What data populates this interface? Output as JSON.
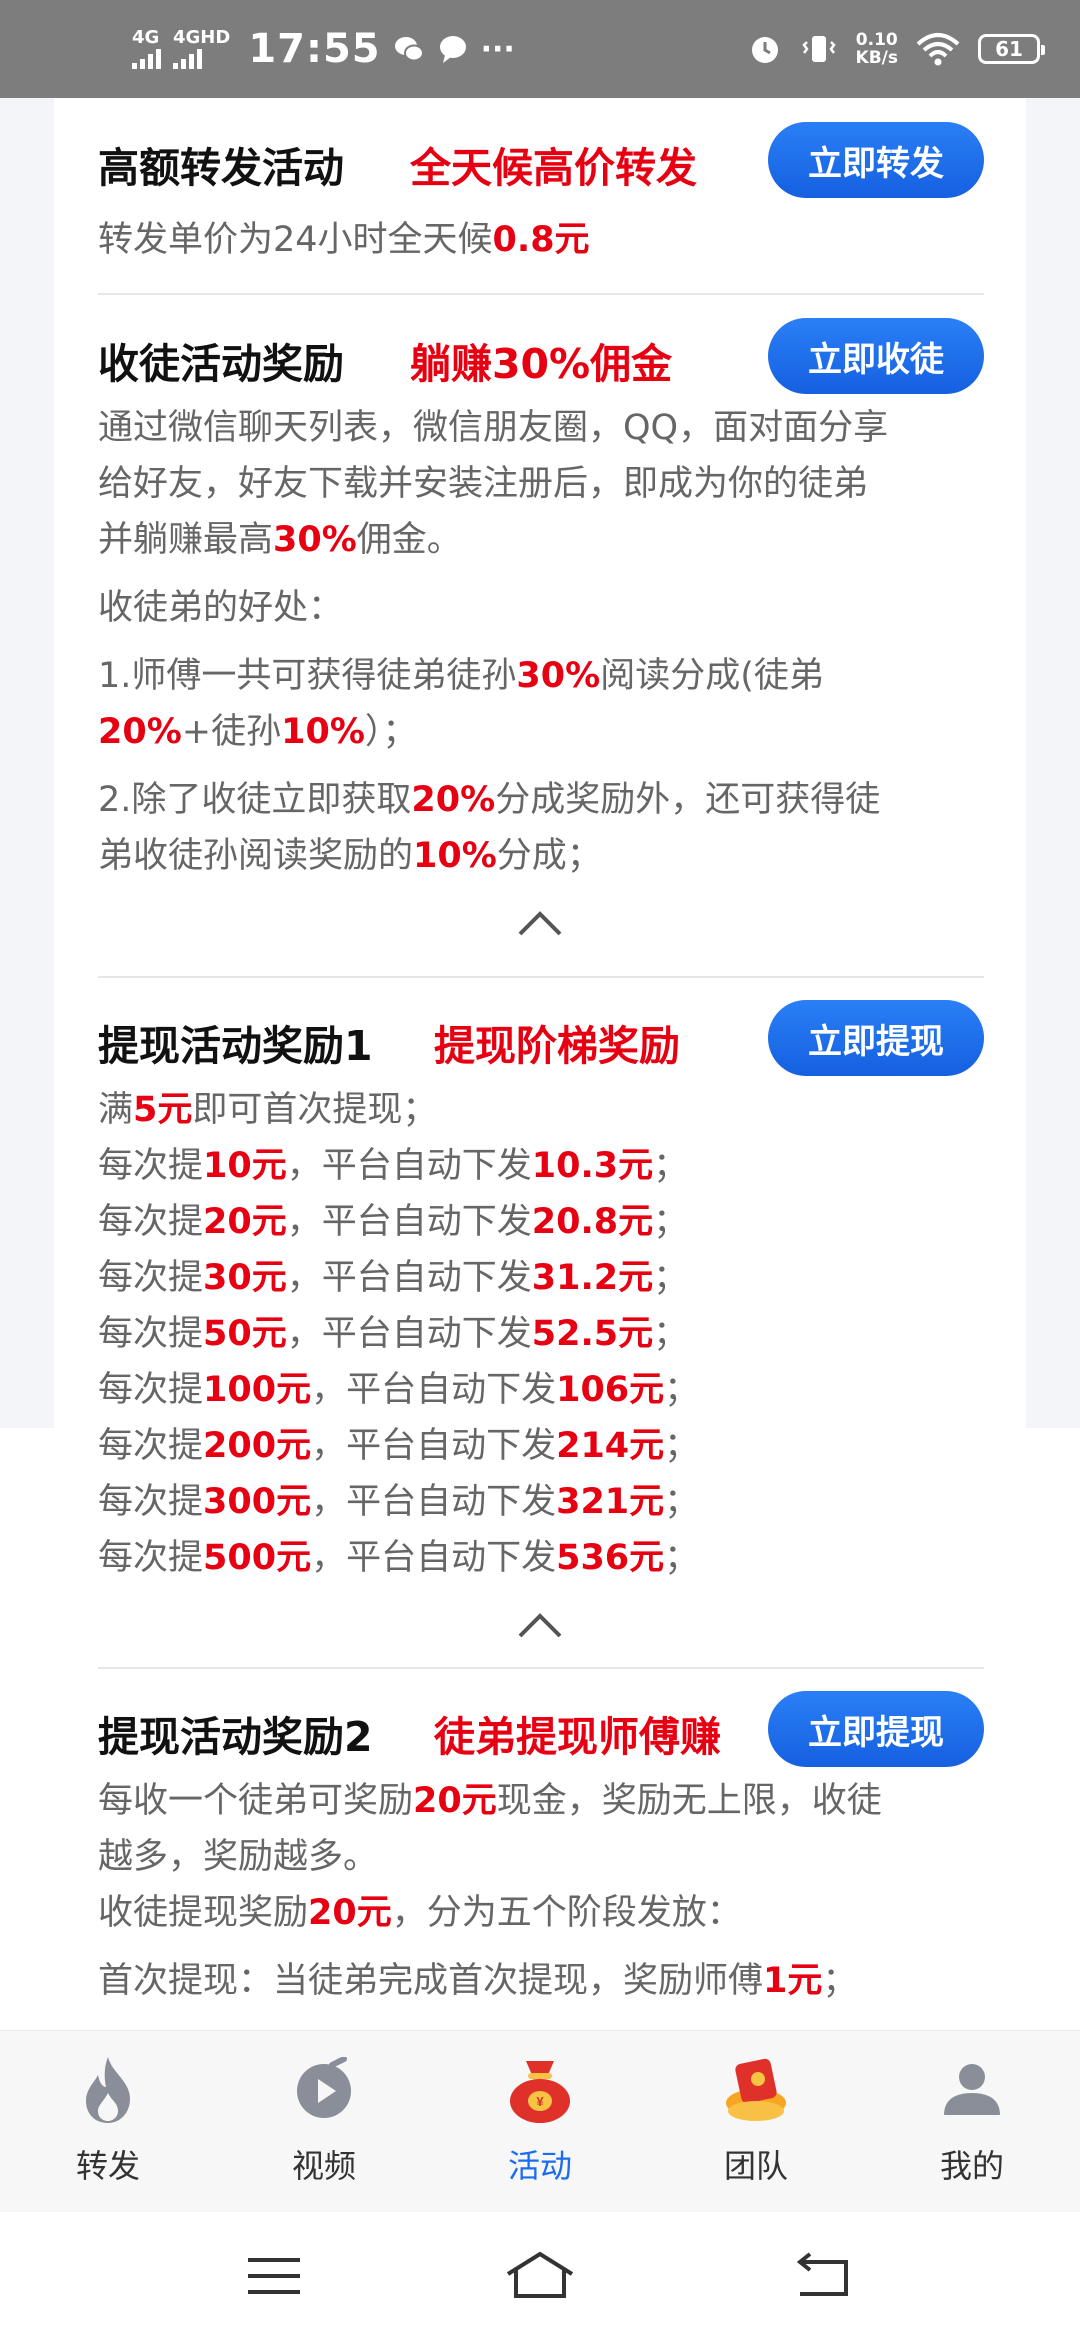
{
  "status_bar": {
    "sim1": "4G",
    "sim2": "4GHD",
    "time": "17:55",
    "more": "···",
    "speed_value": "0.10",
    "speed_unit": "KB/s",
    "battery": "61"
  },
  "sections": {
    "forward": {
      "title": "高额转发活动",
      "highlight": "全天候高价转发",
      "button": "立即转发",
      "line1_prefix": "转发单价为24小时全天候",
      "line1_value": "0.8元"
    },
    "recruit": {
      "title": "收徒活动奖励",
      "highlight": "躺赚30%佣金",
      "button": "立即收徒",
      "p1_l1": "通过微信聊天列表，微信朋友圈，QQ，面对面分享",
      "p1_l2": "给好友，好友下载并安装注册后，即成为你的徒弟",
      "p1_l3_a": "并躺赚最高",
      "p1_l3_b": "30%",
      "p1_l3_c": "佣金。",
      "benefit_title": "收徒弟的好处：",
      "b1_a": "1.师傅一共可获得徒弟徒孙",
      "b1_b": "30%",
      "b1_c": "阅读分成(徒弟",
      "b1_d": "20%",
      "b1_e": "+徒孙",
      "b1_f": "10%",
      "b1_g": "）；",
      "b2_a": "2.除了收徒立即获取",
      "b2_b": "20%",
      "b2_c": "分成奖励外，还可获得徒",
      "b2_d": "弟收徒孙阅读奖励的",
      "b2_e": "10%",
      "b2_f": "分成；"
    },
    "withdraw1": {
      "title": "提现活动奖励1",
      "highlight": "提现阶梯奖励",
      "button": "立即提现",
      "first_a": "满",
      "first_b": "5元",
      "first_c": "即可首次提现；",
      "row_prefix": "每次提",
      "row_mid": "，平台自动下发",
      "row_end": "；",
      "rows": [
        {
          "amount": "10元",
          "payout": "10.3元"
        },
        {
          "amount": "20元",
          "payout": "20.8元"
        },
        {
          "amount": "30元",
          "payout": "31.2元"
        },
        {
          "amount": "50元",
          "payout": "52.5元"
        },
        {
          "amount": "100元",
          "payout": "106元"
        },
        {
          "amount": "200元",
          "payout": "214元"
        },
        {
          "amount": "300元",
          "payout": "321元"
        },
        {
          "amount": "500元",
          "payout": "536元"
        }
      ]
    },
    "withdraw2": {
      "title": "提现活动奖励2",
      "highlight": "徒弟提现师傅赚",
      "button": "立即提现",
      "l1_a": "每收一个徒弟可奖励",
      "l1_b": "20元",
      "l1_c": "现金，奖励无上限，收徒",
      "l2": "越多，奖励越多。",
      "l3_a": "收徒提现奖励",
      "l3_b": "20元",
      "l3_c": "，分为五个阶段发放：",
      "l4_a": "首次提现：当徒弟完成首次提现，奖励师傅",
      "l4_b": "1元",
      "l4_c": "；"
    }
  },
  "nav": {
    "items": [
      {
        "label": "转发"
      },
      {
        "label": "视频"
      },
      {
        "label": "活动"
      },
      {
        "label": "团队"
      },
      {
        "label": "我的"
      }
    ]
  },
  "colors": {
    "accent_blue": "#1a6cf0",
    "highlight_red": "#e60012",
    "status_bar": "#7d7d7d"
  }
}
